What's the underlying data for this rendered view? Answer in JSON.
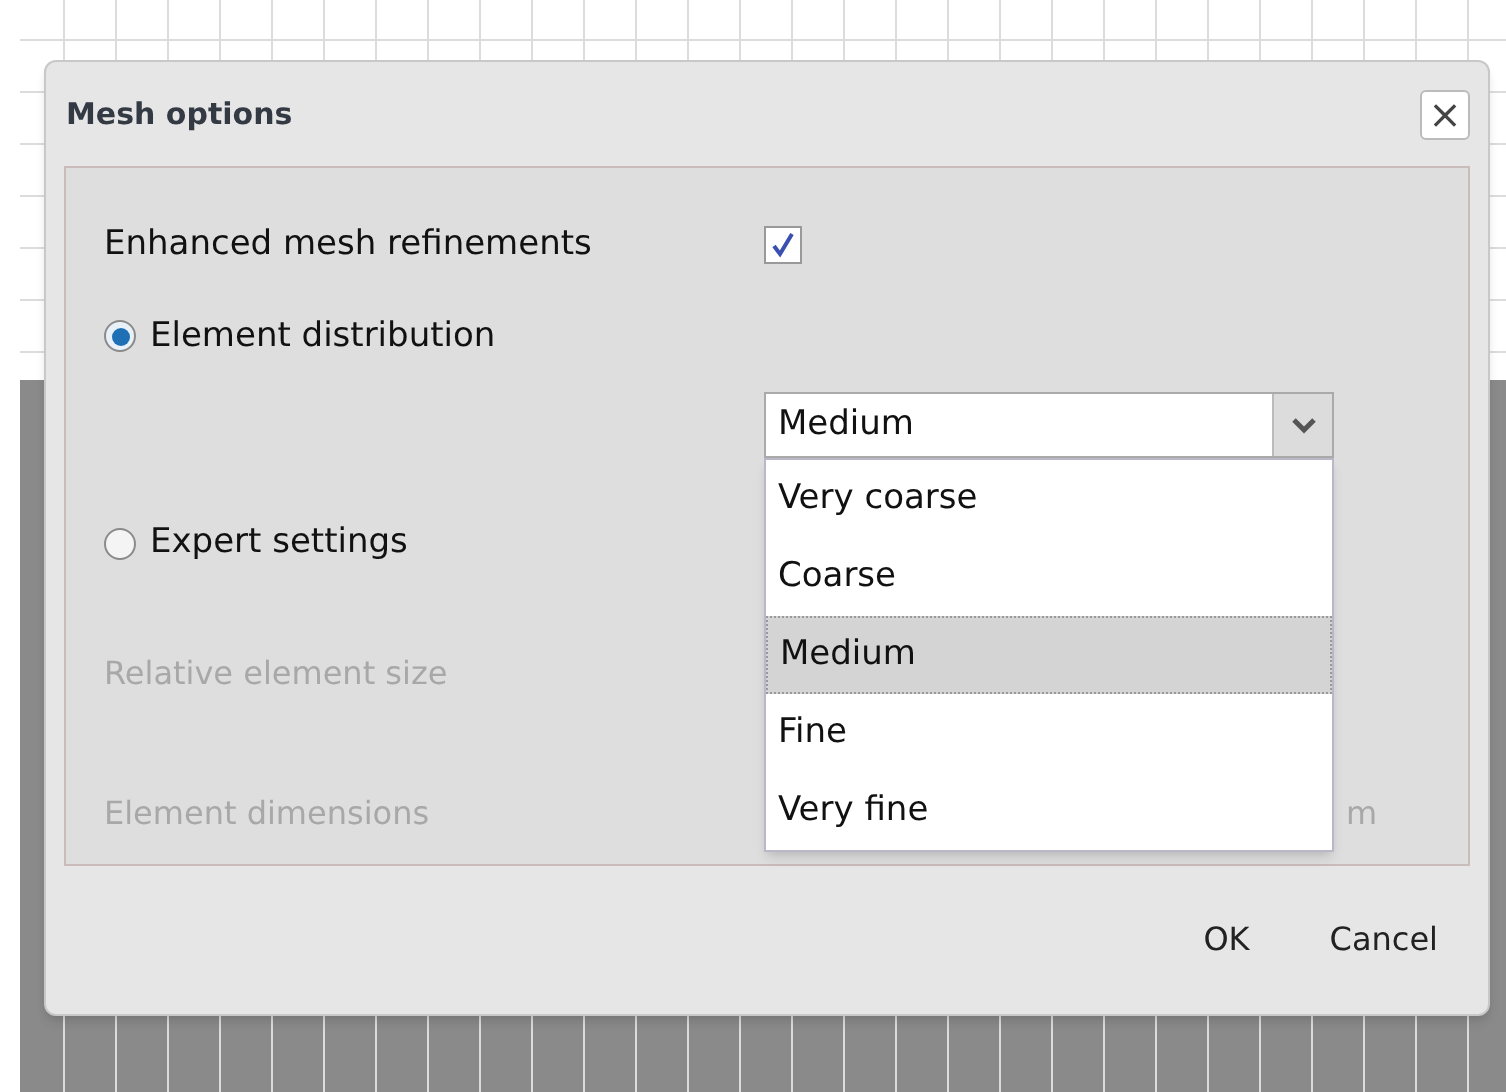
{
  "dialog": {
    "title": "Mesh options",
    "close": "×"
  },
  "refinement": {
    "label": "Enhanced mesh refinements",
    "checked": true
  },
  "distribution_options": [
    {
      "label": "Element distribution",
      "selected": true
    },
    {
      "label": "Expert settings",
      "selected": false
    }
  ],
  "distribution_select": {
    "value": "Medium",
    "expanded": true,
    "options": [
      {
        "label": "Very coarse",
        "selected": false
      },
      {
        "label": "Coarse",
        "selected": false
      },
      {
        "label": "Medium",
        "selected": true
      },
      {
        "label": "Fine",
        "selected": false
      },
      {
        "label": "Very fine",
        "selected": false
      }
    ]
  },
  "expert_fields": [
    {
      "label": "Relative element size",
      "disabled": true
    },
    {
      "label": "Element dimensions",
      "disabled": true,
      "unit": "m"
    }
  ],
  "buttons": [
    "OK",
    "Cancel"
  ]
}
